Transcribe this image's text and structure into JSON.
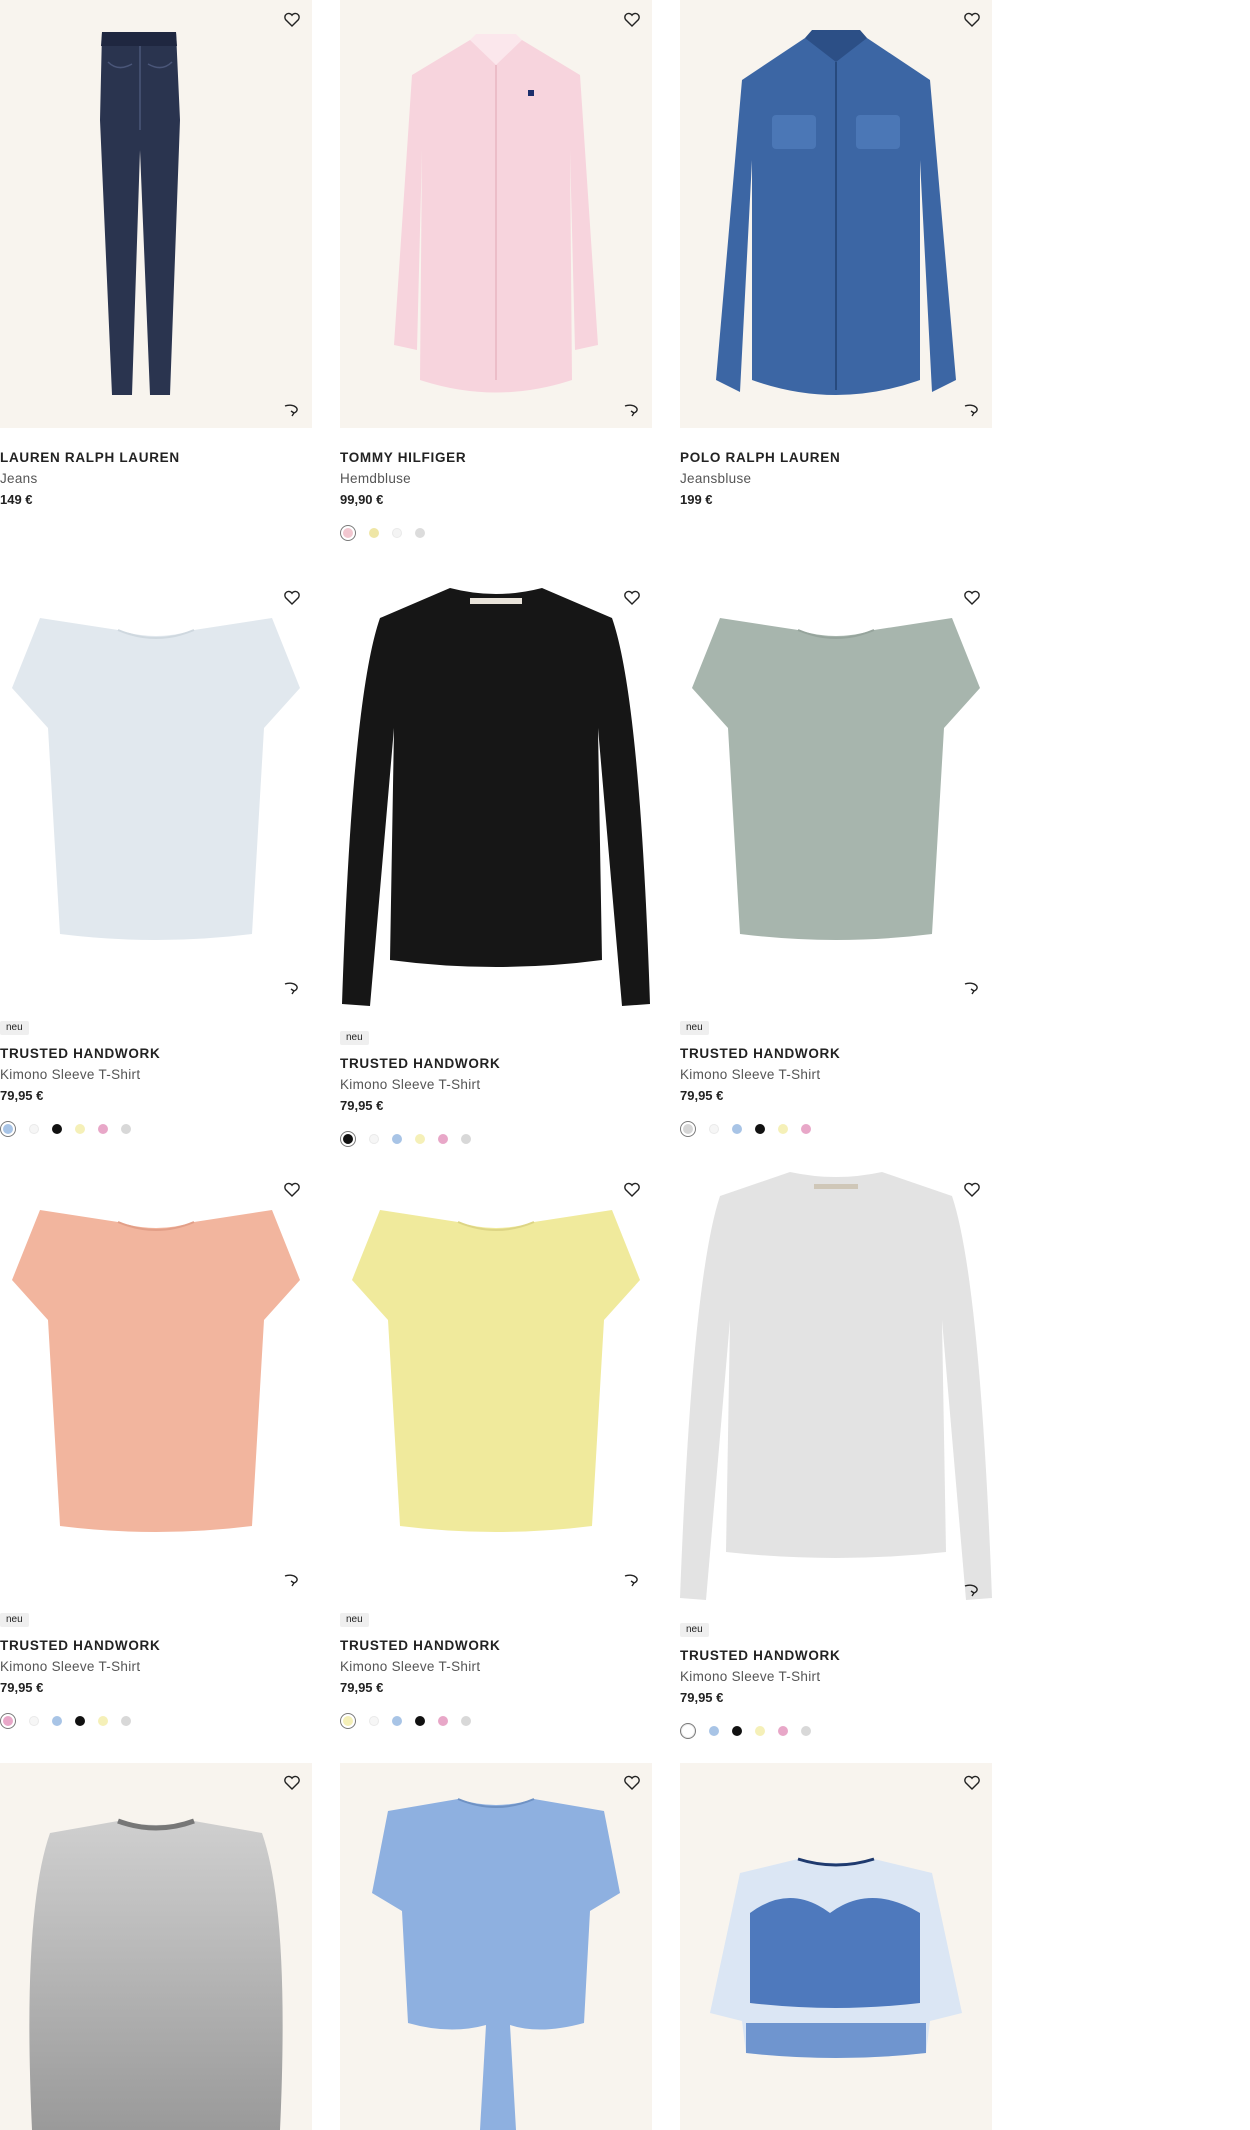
{
  "products": [
    {
      "brand": "LAUREN RALPH LAUREN",
      "name": "Jeans",
      "price": "149 €",
      "badge": "",
      "swatches": []
    },
    {
      "brand": "TOMMY HILFIGER",
      "name": "Hemdbluse",
      "price": "99,90 €",
      "badge": "",
      "swatches": [
        "#f2c7d0",
        "#efe6a6",
        "#f4f4f4",
        "#dcdcdc"
      ]
    },
    {
      "brand": "POLO RALPH LAUREN",
      "name": "Jeansbluse",
      "price": "199 €",
      "badge": "",
      "swatches": []
    },
    {
      "brand": "TRUSTED HANDWORK",
      "name": "Kimono Sleeve T-Shirt",
      "price": "79,95 €",
      "badge": "neu",
      "swatches": [
        "#a8c4e6",
        "#f6f6f6",
        "#111111",
        "#f5f0b8",
        "#e8a7c8",
        "#d8d8d8"
      ]
    },
    {
      "brand": "TRUSTED HANDWORK",
      "name": "Kimono Sleeve T-Shirt",
      "price": "79,95 €",
      "badge": "neu",
      "swatches": [
        "#111111",
        "#f6f6f6",
        "#a8c4e6",
        "#f5f0b8",
        "#e8a7c8",
        "#d8d8d8"
      ]
    },
    {
      "brand": "TRUSTED HANDWORK",
      "name": "Kimono Sleeve T-Shirt",
      "price": "79,95 €",
      "badge": "neu",
      "swatches": [
        "#d6d6d6",
        "#f6f6f6",
        "#a8c4e6",
        "#111111",
        "#f5f0b8",
        "#e8a7c8"
      ]
    },
    {
      "brand": "TRUSTED HANDWORK",
      "name": "Kimono Sleeve T-Shirt",
      "price": "79,95 €",
      "badge": "neu",
      "swatches": [
        "#e8a7c8",
        "#f6f6f6",
        "#a8c4e6",
        "#111111",
        "#f5f0b8",
        "#d8d8d8"
      ]
    },
    {
      "brand": "TRUSTED HANDWORK",
      "name": "Kimono Sleeve T-Shirt",
      "price": "79,95 €",
      "badge": "neu",
      "swatches": [
        "#f5f0b8",
        "#f6f6f6",
        "#a8c4e6",
        "#111111",
        "#e8a7c8",
        "#d8d8d8"
      ]
    },
    {
      "brand": "TRUSTED HANDWORK",
      "name": "Kimono Sleeve T-Shirt",
      "price": "79,95 €",
      "badge": "neu",
      "swatches": [
        "#ffffff",
        "#a8c4e6",
        "#111111",
        "#f5f0b8",
        "#e8a7c8",
        "#d8d8d8"
      ]
    },
    {
      "brand": "",
      "name": "",
      "price": "",
      "badge": "",
      "swatches": []
    },
    {
      "brand": "",
      "name": "",
      "price": "",
      "badge": "",
      "swatches": []
    },
    {
      "brand": "",
      "name": "",
      "price": "",
      "badge": "",
      "swatches": []
    }
  ],
  "icons": {
    "favorite": "heart-icon",
    "view_in_room": "ar-view-icon"
  }
}
